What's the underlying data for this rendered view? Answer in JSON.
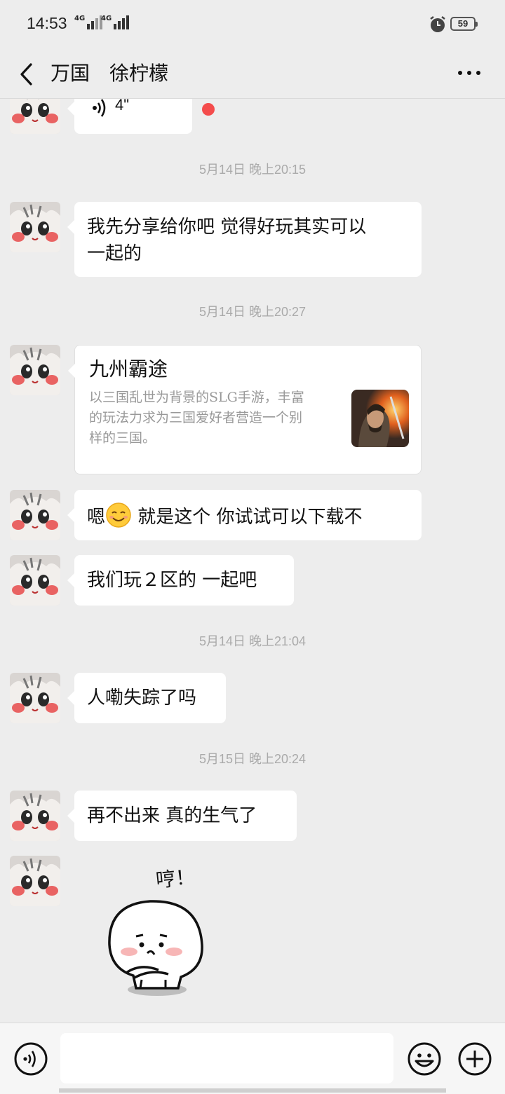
{
  "status_bar": {
    "time": "14:53",
    "signal1_label": "4G",
    "signal2_label": "4G",
    "battery": "59"
  },
  "header": {
    "title": "万国　徐柠檬",
    "back_icon": "chevron-left-icon",
    "more_icon": "more-dots-icon"
  },
  "messages": [
    {
      "type": "voice",
      "duration": "4\"",
      "unread": true
    },
    {
      "type": "time",
      "text": "5月14日 晚上20:15"
    },
    {
      "type": "text",
      "line1": "我先分享给你吧 觉得好玩其实可以",
      "line2": "一起的"
    },
    {
      "type": "time",
      "text": "5月14日 晚上20:27"
    },
    {
      "type": "card",
      "title": "九州霸途",
      "desc_line1": "以三国乱世为背景的SLG手游，丰富",
      "desc_line2": "的玩法力求为三国爱好者营造一个别",
      "desc_line3": "样的三国。"
    },
    {
      "type": "text",
      "before_emoji": "嗯",
      "emoji": "smiling-face-emoji",
      "after_emoji": " 就是这个 你试试可以下载不"
    },
    {
      "type": "text",
      "text": "我们玩２区的 一起吧"
    },
    {
      "type": "time",
      "text": "5月14日 晚上21:04"
    },
    {
      "type": "text",
      "text": "人嘞失踪了吗"
    },
    {
      "type": "time",
      "text": "5月15日 晚上20:24"
    },
    {
      "type": "text",
      "text": "再不出来 真的生气了"
    },
    {
      "type": "sticker",
      "caption": "哼！"
    }
  ],
  "input_bar": {
    "voice_icon": "voice-input-icon",
    "input_value": "",
    "emoji_icon": "emoji-icon",
    "plus_icon": "plus-icon"
  },
  "colors": {
    "background": "#ededed",
    "bubble": "#ffffff",
    "unread_dot": "#f44c4c",
    "timestamp": "#aaaaaa"
  }
}
